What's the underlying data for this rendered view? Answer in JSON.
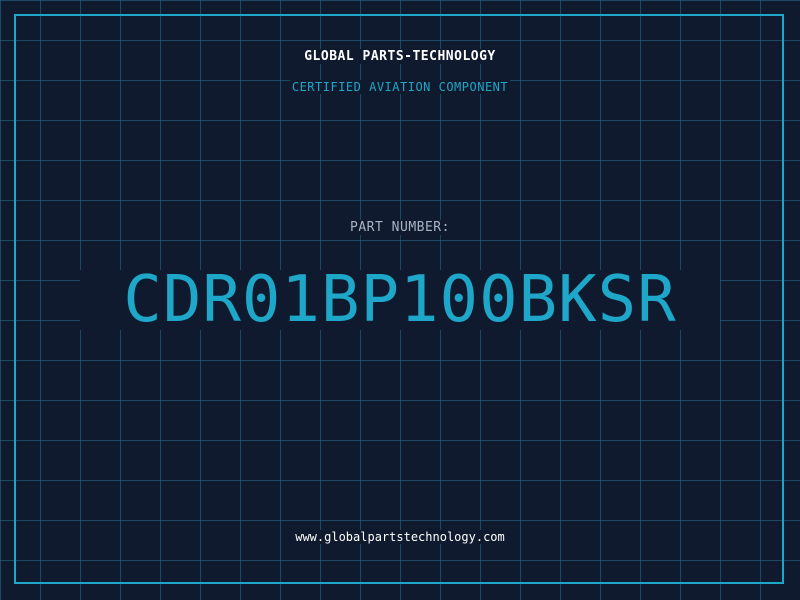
{
  "header": {
    "company": "GLOBAL PARTS-TECHNOLOGY",
    "subtitle": "CERTIFIED AVIATION COMPONENT"
  },
  "part": {
    "label": "PART NUMBER:",
    "number": "CDR01BP100BKSR"
  },
  "footer": {
    "website": "www.globalpartstechnology.com"
  },
  "colors": {
    "background": "#0f1a2e",
    "accent": "#1ea7c9",
    "grid": "#286e8c",
    "text": "#ffffff",
    "muted": "#a9b4c4"
  }
}
